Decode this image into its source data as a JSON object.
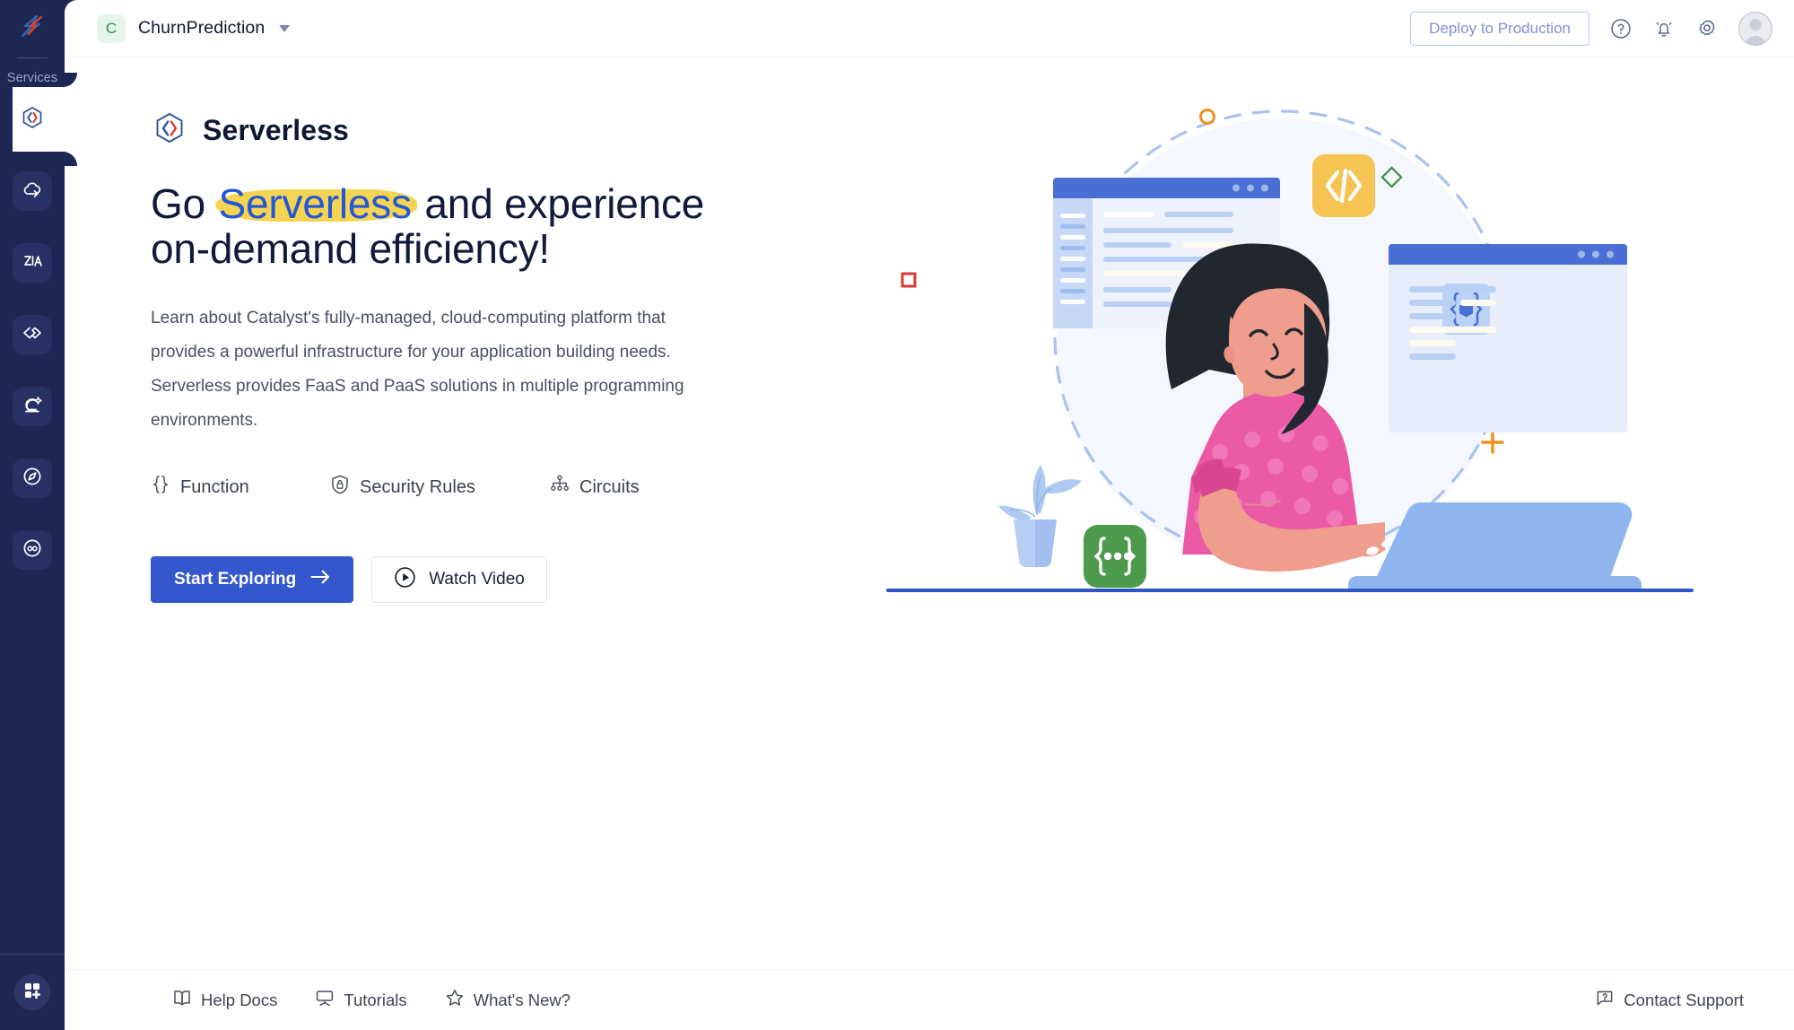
{
  "sidebar": {
    "logo_icon": "catalyst-logo-icon",
    "services_label": "Services",
    "items": [
      {
        "name": "serverless",
        "icon": "code-hexagon-icon",
        "active": true
      },
      {
        "name": "cloud-scale",
        "icon": "cloud-arrow-icon",
        "active": false
      },
      {
        "name": "zia-ai",
        "icon": "zia-ai-icon",
        "active": false
      },
      {
        "name": "devops",
        "icon": "double-chevron-icon",
        "active": false
      },
      {
        "name": "quickml",
        "icon": "crystal-ball-sparkle-icon",
        "active": false
      },
      {
        "name": "signals",
        "icon": "compass-icon",
        "active": false
      },
      {
        "name": "monitoring",
        "icon": "goggles-icon",
        "active": false
      }
    ],
    "apps_icon": "grid-plus-icon"
  },
  "header": {
    "project_initial": "C",
    "project_name": "ChurnPrediction",
    "project_caret_icon": "chevron-down-icon",
    "deploy_label": "Deploy to Production",
    "help_icon": "help-circle-icon",
    "notifications_icon": "bell-icon",
    "settings_icon": "gear-icon",
    "avatar_icon": "user-avatar"
  },
  "hero": {
    "brand_icon": "serverless-hexagon-icon",
    "brand_title": "Serverless",
    "headline_pre": "Go ",
    "headline_mark": "Serverless",
    "headline_post": " and experience on-demand efficiency!",
    "description": "Learn about Catalyst's fully-managed, cloud-computing platform that provides a powerful infrastructure for your application building needs. Serverless provides FaaS and PaaS solutions in multiple programming environments.",
    "features": [
      {
        "label": "Function",
        "icon": "curly-braces-icon"
      },
      {
        "label": "Security Rules",
        "icon": "shield-lock-icon"
      },
      {
        "label": "Circuits",
        "icon": "hierarchy-tree-icon"
      }
    ],
    "primary_cta": "Start Exploring",
    "primary_cta_icon": "arrow-right-icon",
    "secondary_cta": "Watch Video",
    "secondary_cta_icon": "play-circle-icon"
  },
  "illustration": {
    "code_badge_label": "</>",
    "json_badge_label": "{...}",
    "window_badge_label": "{ }",
    "accent_orange": "#f09020",
    "accent_red": "#d93b32",
    "accent_green": "#3f8f3f",
    "accent_yellow": "#f5c453",
    "accent_blue": "#4a6fd4",
    "skin": "#ef9e8e",
    "shirt": "#ea5aa5",
    "hair": "#22272f"
  },
  "footer": {
    "links": [
      {
        "label": "Help Docs",
        "icon": "book-open-icon"
      },
      {
        "label": "Tutorials",
        "icon": "presentation-board-icon"
      },
      {
        "label": "What's New?",
        "icon": "star-icon"
      }
    ],
    "support": {
      "label": "Contact Support",
      "icon": "chat-question-icon"
    }
  }
}
